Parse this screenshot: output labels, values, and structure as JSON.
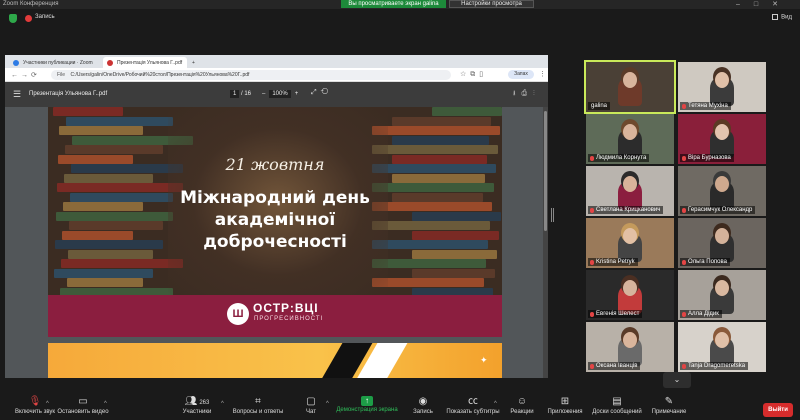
{
  "window": {
    "title": "Zoom Конференция",
    "controls": [
      "–",
      "□",
      "✕"
    ]
  },
  "share_banner": "Вы просматриваете экран galina",
  "view_settings": "Настройки просмотра",
  "recording": {
    "label": "Запись"
  },
  "view_button": "Вид",
  "browser": {
    "tabs": [
      {
        "label": "Участники публикации · Zoom",
        "active": false
      },
      {
        "label": "Презентація Ульянова Г..pdf",
        "active": true
      },
      {
        "label": "+",
        "active": false
      }
    ],
    "url": "C:/Users/galin/OneDrive/Робочий%20стол/Презентація%20Ульянова%20Г..pdf",
    "url_prefix": "File",
    "profile_label": "Запах"
  },
  "pdf": {
    "file_name": "Презентація Ульянова Г..pdf",
    "page_current": "1",
    "page_total": "/ 16",
    "zoom": "100%",
    "slide": {
      "date": "21 жовтня",
      "title_lines": [
        "Міжнародний день",
        "академічної",
        "доброчесності"
      ],
      "logo_mark": "Ш",
      "logo_main": "ОСТР:ВЦІ",
      "logo_sub": "ПРОГРЕСИВНОСТІ"
    }
  },
  "participants": [
    {
      "name": "galina",
      "active": true,
      "bg": "#4a4036",
      "skin": "#d8b49c",
      "hair": "#5a3b28",
      "shirt": "#6e3a2a",
      "muted": false
    },
    {
      "name": "Тетяна Мухіна",
      "active": false,
      "bg": "#cfc9c1",
      "skin": "#e0c0a8",
      "hair": "#4a3325",
      "shirt": "#3b3b3b",
      "muted": true
    },
    {
      "name": "Людмила Корнута",
      "active": false,
      "bg": "#5e6b58",
      "skin": "#d9b59c",
      "hair": "#6e4a2d",
      "shirt": "#2c2c2c",
      "muted": true
    },
    {
      "name": "Віра Бурназова",
      "active": false,
      "bg": "#8a1f3a",
      "skin": "#e2c4ae",
      "hair": "#5b3a24",
      "shirt": "#2f2f2f",
      "muted": true
    },
    {
      "name": "Светлана Крицканович",
      "active": false,
      "bg": "#b9b4ae",
      "skin": "#d8b39a",
      "hair": "#2b2b2b",
      "shirt": "#8b1e3f",
      "muted": true
    },
    {
      "name": "Герасимчук Олександр",
      "active": false,
      "bg": "#6f6a63",
      "skin": "#cfa98e",
      "hair": "#3a3a3a",
      "shirt": "#2a2a2a",
      "muted": true
    },
    {
      "name": "Kristina Petryk",
      "active": false,
      "bg": "#9a7a5a",
      "skin": "#e2c0a4",
      "hair": "#c49a5c",
      "shirt": "#444",
      "muted": true
    },
    {
      "name": "Ольга Попова",
      "active": false,
      "bg": "#6b655f",
      "skin": "#d4b29a",
      "hair": "#3d2a1e",
      "shirt": "#2f2f2f",
      "muted": true
    },
    {
      "name": "Евгенія Шелест",
      "active": false,
      "bg": "#2a2a2a",
      "skin": "#d6b39c",
      "hair": "#4b2f22",
      "shirt": "#c23b3b",
      "muted": true
    },
    {
      "name": "Алла Дідик",
      "active": false,
      "bg": "#a7a19a",
      "skin": "#d9b8a0",
      "hair": "#3c2a1f",
      "shirt": "#3a3a3a",
      "muted": true
    },
    {
      "name": "Оксана Іванців",
      "active": false,
      "bg": "#b8b1a8",
      "skin": "#d9b59c",
      "hair": "#5a3b28",
      "shirt": "#6a6a6a",
      "muted": true
    },
    {
      "name": "Tanja Dragomeretska",
      "active": false,
      "bg": "#d7d2cb",
      "skin": "#e0c0a8",
      "hair": "#8a5a3a",
      "shirt": "#4a4a4a",
      "muted": true
    }
  ],
  "toolbar": {
    "audio": "Включить звук",
    "video": "Остановить видео",
    "participants": "Участники",
    "participants_count": "263",
    "qa": "Вопросы и ответы",
    "chat": "Чат",
    "share": "Демонстрация экрана",
    "record": "Запись",
    "captions": "Показать субтитры",
    "reactions": "Реакции",
    "apps": "Приложения",
    "whiteboards": "Доски сообщений",
    "notes": "Примечание",
    "leave": "Выйти"
  }
}
